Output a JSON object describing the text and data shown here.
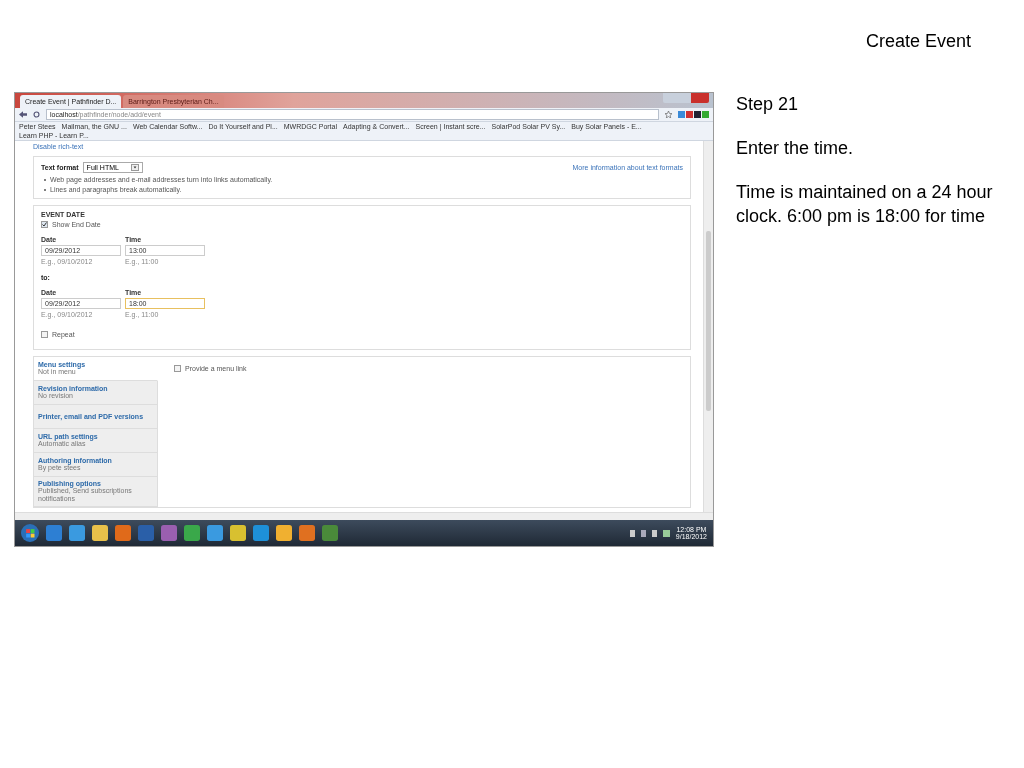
{
  "slide": {
    "title": "Create Event",
    "step": "Step 21",
    "paragraphs": [
      "Enter the time.",
      "Time is maintained on a 24 hour clock.  6:00 pm is 18:00 for time"
    ]
  },
  "browser": {
    "tabs": [
      {
        "label": "Create Event | Pathfinder D...",
        "selected": true
      },
      {
        "label": "Barrington Presbyterian Ch...",
        "selected": false
      }
    ],
    "address": {
      "host": "localhost",
      "path": "/pathfinder/node/add/event"
    },
    "bookmarks": [
      "Peter Stees",
      "Mailman, the GNU ...",
      "Web Calendar Softw...",
      "Do It Yourself and Pl...",
      "MWRDGC Portal",
      "Adapting & Convert...",
      "Screen | Instant scre...",
      "SolarPod Solar PV Sy...",
      "Buy Solar Panels - E...",
      "Learn PHP - Learn P..."
    ]
  },
  "page": {
    "rich_text_link": "Disable rich-text",
    "text_format": {
      "label": "Text format",
      "value": "Full HTML",
      "help_link": "More information about text formats",
      "tips": [
        "Web page addresses and e-mail addresses turn into links automatically.",
        "Lines and paragraphs break automatically."
      ]
    },
    "event_date": {
      "legend": "EVENT DATE",
      "show_end": {
        "label": "Show End Date",
        "checked": true
      },
      "to_label": "to:",
      "rows": [
        {
          "date_label": "Date",
          "time_label": "Time",
          "date": "09/29/2012",
          "time": "13:00",
          "date_hint": "E.g., 09/10/2012",
          "time_hint": "E.g., 11:00",
          "focused": false
        },
        {
          "date_label": "Date",
          "time_label": "Time",
          "date": "09/29/2012",
          "time": "18:00",
          "date_hint": "E.g., 09/10/2012",
          "time_hint": "E.g., 11:00",
          "focused": true
        }
      ],
      "repeat": {
        "label": "Repeat",
        "checked": false
      }
    },
    "vertical_tabs": [
      {
        "title": "Menu settings",
        "summary": "Not in menu",
        "selected": true
      },
      {
        "title": "Revision information",
        "summary": "No revision",
        "selected": false
      },
      {
        "title": "Printer, email and PDF versions",
        "selected": false
      },
      {
        "title": "URL path settings",
        "summary": "Automatic alias",
        "selected": false
      },
      {
        "title": "Authoring information",
        "summary": "By pete stees",
        "selected": false
      },
      {
        "title": "Publishing options",
        "summary": "Published, Send subscriptions notifications",
        "selected": false
      }
    ],
    "menu_link": {
      "label": "Provide a menu link",
      "checked": false
    }
  },
  "taskbar": {
    "time": "12:08 PM",
    "date": "9/18/2012"
  }
}
